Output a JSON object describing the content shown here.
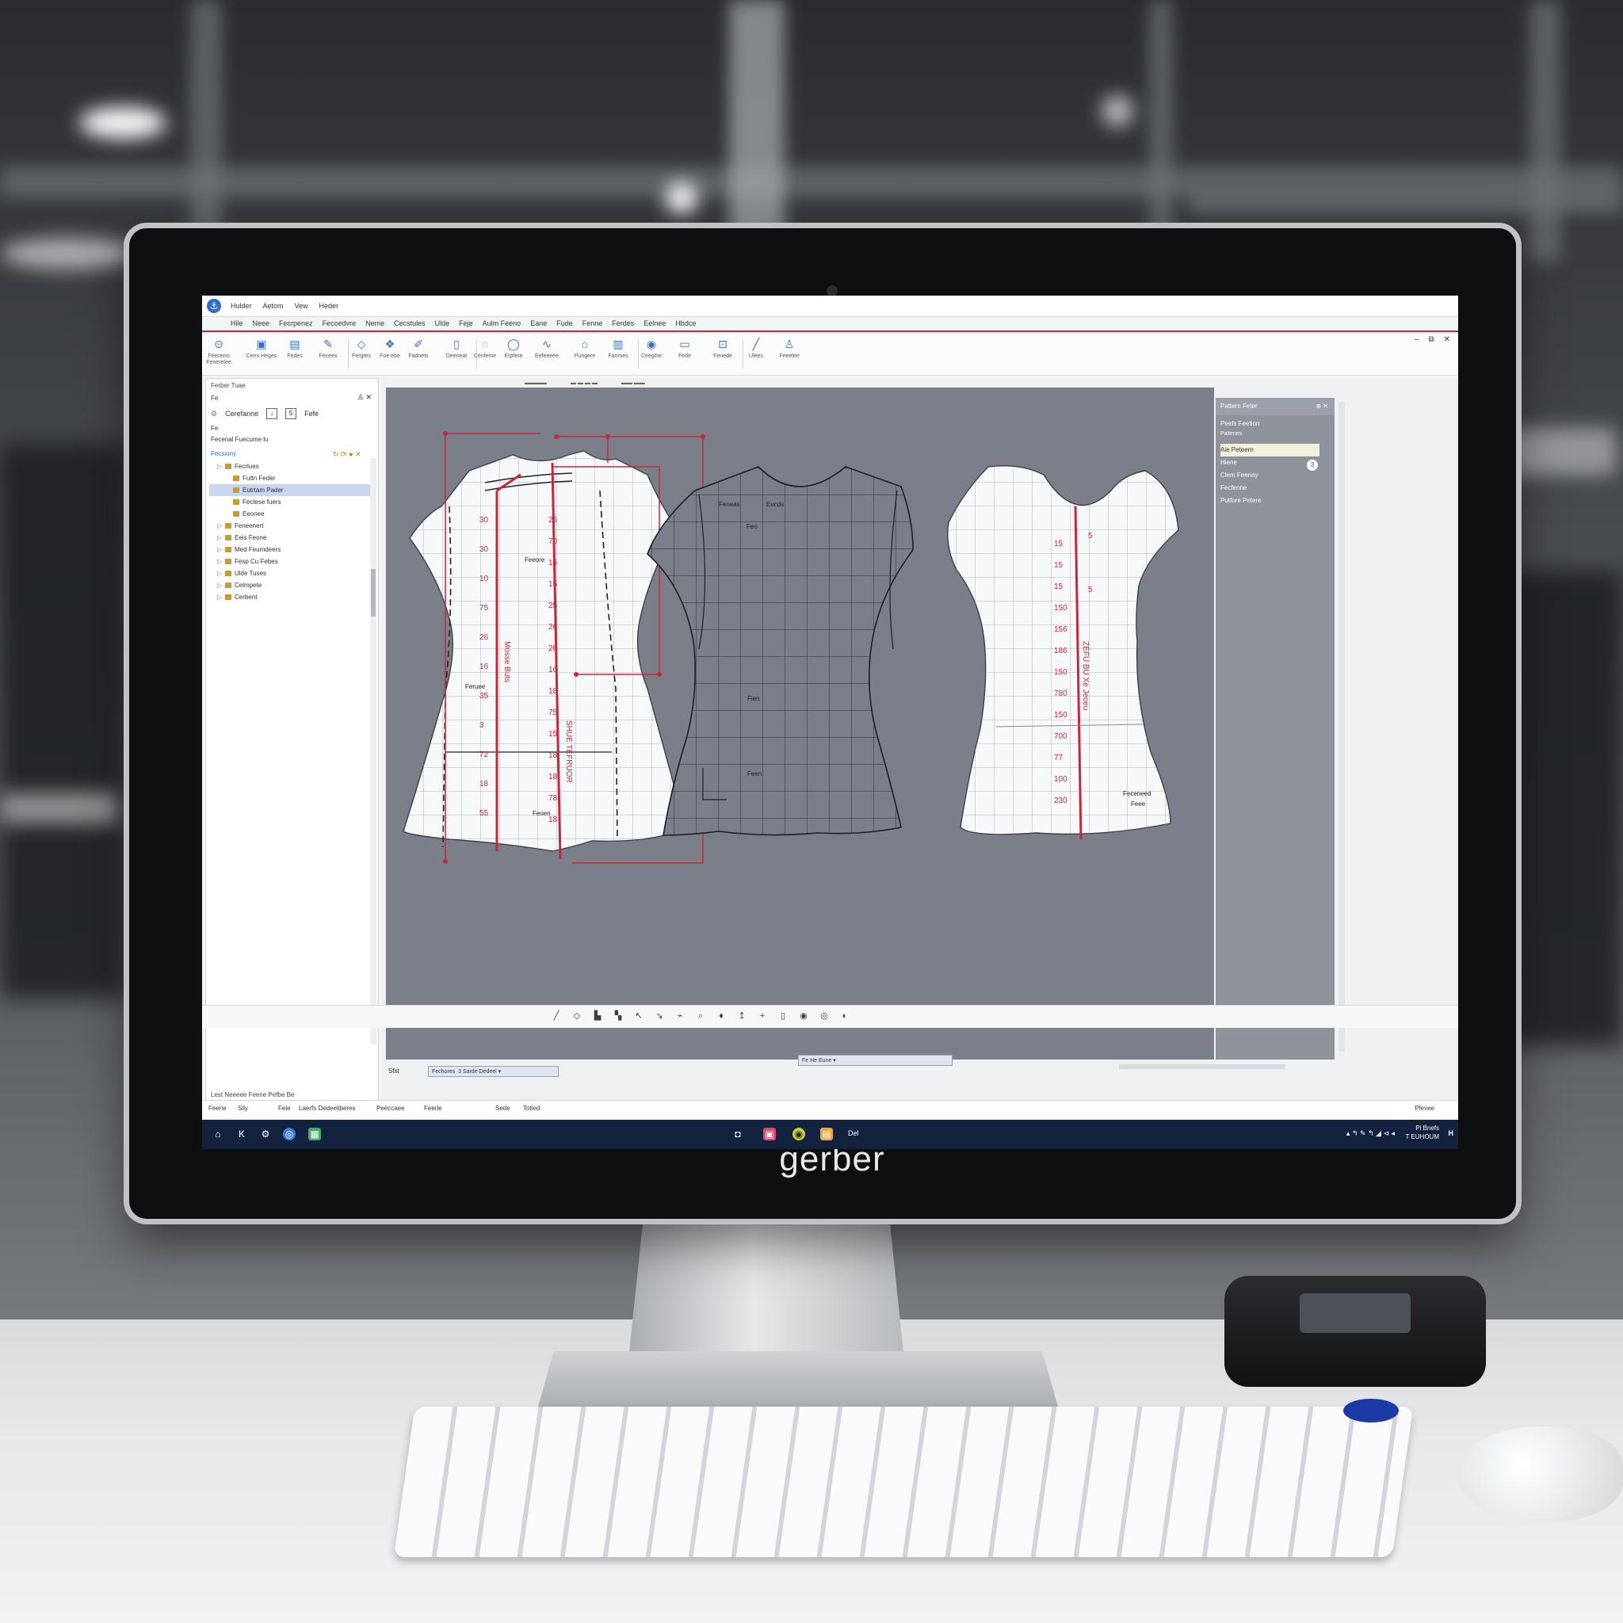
{
  "brand": "gerber",
  "app": {
    "menu": [
      "Hulder",
      "Aetom",
      "Vew",
      "Heder"
    ],
    "ribbon_tabs": [
      "Hile",
      "Neee",
      "Fecrpenez",
      "Fecoedvre",
      "Neme",
      "Cecstules",
      "Ulde",
      "Feje",
      "Aulm Feeno",
      "Eane",
      "Fude",
      "Fenne",
      "Ferdes",
      "Eelnee",
      "Hbdce"
    ],
    "ribbon_buttons": [
      {
        "icon": "⊙",
        "label": "Feeceno Fenerelee"
      },
      {
        "icon": "▣",
        "label": "Cens Heges"
      },
      {
        "icon": "▤",
        "label": "Fedes"
      },
      {
        "icon": "✎",
        "label": "Fecees"
      },
      {
        "icon": "◇",
        "label": "Fergtes"
      },
      {
        "icon": "❖",
        "label": "Foe ebe"
      },
      {
        "icon": "✐",
        "label": "Fadnets"
      },
      {
        "icon": "▯",
        "label": "Deeneat"
      },
      {
        "icon": "◌",
        "label": "Cenfeme"
      },
      {
        "icon": "◯",
        "label": "Erpfere"
      },
      {
        "icon": "∿",
        "label": "Eefeeeee"
      },
      {
        "icon": "⌂",
        "label": "Pungere"
      },
      {
        "icon": "▥",
        "label": "Fanmes"
      },
      {
        "icon": "◉",
        "label": "Ceeglne"
      },
      {
        "icon": "▭",
        "label": "Fede"
      },
      {
        "icon": "⊡",
        "label": "Fenede"
      },
      {
        "icon": "╱",
        "label": "Ulees"
      },
      {
        "icon": "♙",
        "label": "Feeelee"
      }
    ]
  },
  "left_panel": {
    "title": "Ferber Tuae",
    "search": "Fe",
    "tools": [
      "Cerefanne",
      "Fefe"
    ],
    "row2": "Fe",
    "row3": "Fecenal  Fuecume lu",
    "tree_header": "Fecsiony",
    "tree": [
      {
        "label": "Fecrlues",
        "indent": 1,
        "sel": false
      },
      {
        "label": "Futtn Feder",
        "indent": 2,
        "sel": false
      },
      {
        "label": "Eutrtam Pader",
        "indent": 2,
        "sel": true
      },
      {
        "label": "Fectese fuers",
        "indent": 2,
        "sel": false
      },
      {
        "label": "Eeonee",
        "indent": 2,
        "sel": false
      },
      {
        "label": "Feneenert",
        "indent": 1,
        "sel": false
      },
      {
        "label": "Eeis Feone",
        "indent": 1,
        "sel": false
      },
      {
        "label": "Med Feumdeers",
        "indent": 1,
        "sel": false
      },
      {
        "label": "Fesp Cu Febes",
        "indent": 1,
        "sel": false
      },
      {
        "label": "Ulde Tuses",
        "indent": 1,
        "sel": false
      },
      {
        "label": "Celmpete",
        "indent": 1,
        "sel": false
      },
      {
        "label": "Cerbent",
        "indent": 1,
        "sel": false
      }
    ],
    "footer": "Lest  Neeeee  Feene Pefbe Be"
  },
  "canvas": {
    "tabs": [
      "▬▬▬▬",
      "▬ ▬ ▬ ▬",
      "▬▬ ▬▬"
    ],
    "piece1": {
      "labels": [
        "Feeore",
        "Feruee",
        "Feoen"
      ],
      "left_nums": [
        "30",
        "30",
        "10",
        "75",
        "26",
        "16",
        "35",
        "3",
        "72",
        "18",
        "55"
      ],
      "right_nums": [
        "25",
        "70",
        "15",
        "15",
        "25",
        "26",
        "26",
        "16",
        "18",
        "75",
        "15",
        "18",
        "18",
        "78",
        "18"
      ],
      "vlabel1": "Mosse Buts",
      "vlabel2": "SHUE TEFRUOR"
    },
    "piece2": {
      "labels": [
        "Feneas",
        "Eucds",
        "Feo",
        "Fien",
        "Feen"
      ]
    },
    "piece3": {
      "nums": [
        "15",
        "15",
        "15",
        "150",
        "156",
        "186",
        "150",
        "780",
        "150",
        "700",
        "77",
        "100",
        "230"
      ],
      "vlabel": "ZEFU BU Xe Jeceu",
      "right_nums": [
        "5",
        "5"
      ],
      "note": [
        "Feceneed",
        "Feee"
      ]
    },
    "dropdown1": "Fechores",
    "dropdown2": "3 Sarde Dedeel",
    "dropdown3": "Fe He Eune",
    "left_corner": "Sfst"
  },
  "right_panel": {
    "title": "Pattern Feter",
    "section": "Peefs Feetion",
    "sub": "Paltenes",
    "items": [
      "Aie Peteern",
      "Hiene",
      "Clem Feenny",
      "Fecfenne",
      "Putfore Petere"
    ],
    "badge": "3"
  },
  "statusbar": {
    "left": [
      "Feene",
      "Sily",
      "Fele",
      "Laerfs Dedeeliberes",
      "Peeccaee",
      "Feerle"
    ],
    "mid": [
      "Sede",
      "Totled"
    ],
    "right": "Pfevee"
  },
  "taskbar": {
    "center_label": "Del",
    "clock_l1": "Pl Bnefs",
    "clock_l2": "T EUHOUM"
  }
}
